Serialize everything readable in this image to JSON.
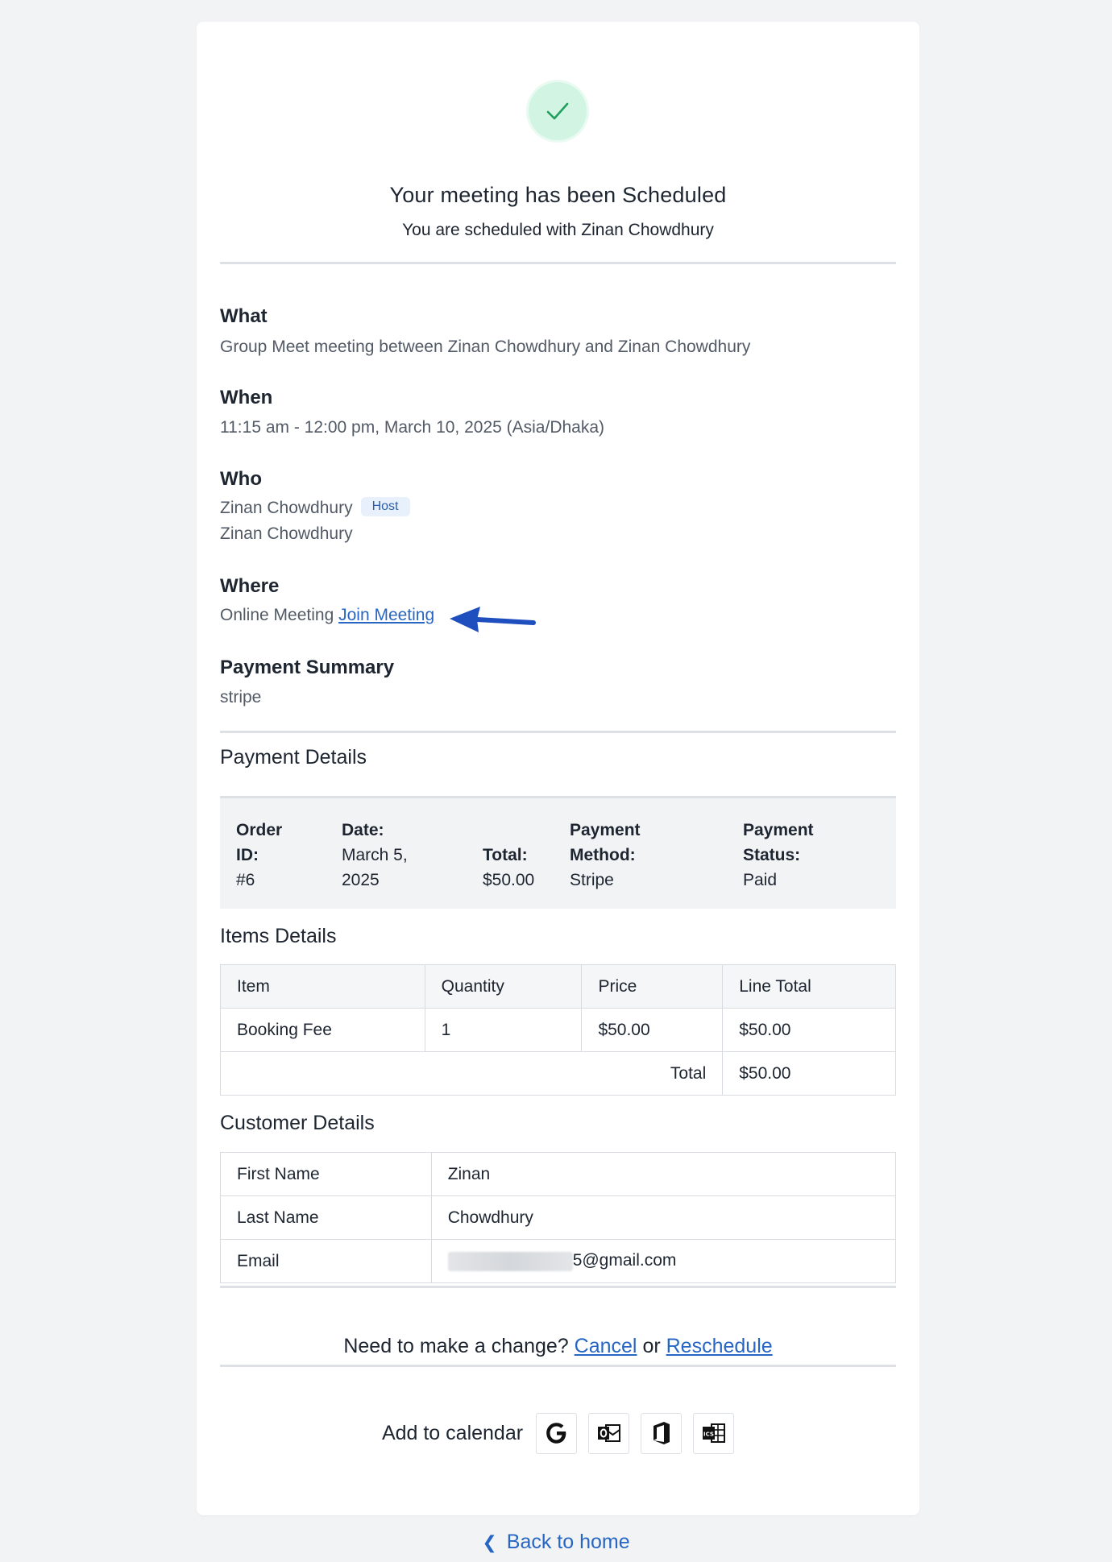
{
  "header": {
    "title": "Your meeting has been Scheduled",
    "subtitle": "You are scheduled with Zinan Chowdhury"
  },
  "what": {
    "label": "What",
    "value": "Group Meet meeting between Zinan Chowdhury and Zinan Chowdhury"
  },
  "when": {
    "label": "When",
    "value": "11:15 am - 12:00 pm, March 10, 2025 (Asia/Dhaka)"
  },
  "who": {
    "label": "Who",
    "host_name": "Zinan Chowdhury",
    "host_badge": "Host",
    "guest_name": "Zinan Chowdhury"
  },
  "where": {
    "label": "Where",
    "value": "Online Meeting",
    "link_text": "Join Meeting"
  },
  "payment_summary": {
    "label": "Payment Summary",
    "value": "stripe"
  },
  "payment_details": {
    "heading": "Payment Details",
    "order_id_label_1": "Order",
    "order_id_label_2": "ID:",
    "order_id_value": "#6",
    "date_label": "Date:",
    "date_value_1": "March 5,",
    "date_value_2": "2025",
    "total_label": "Total:",
    "total_value": "$50.00",
    "method_label_1": "Payment",
    "method_label_2": "Method:",
    "method_value": "Stripe",
    "status_label_1": "Payment",
    "status_label_2": "Status:",
    "status_value": "Paid"
  },
  "items": {
    "heading": "Items Details",
    "columns": [
      "Item",
      "Quantity",
      "Price",
      "Line Total"
    ],
    "rows": [
      [
        "Booking Fee",
        "1",
        "$50.00",
        "$50.00"
      ]
    ],
    "total_label": "Total",
    "total_value": "$50.00"
  },
  "customer": {
    "heading": "Customer Details",
    "rows": [
      [
        "First Name",
        "Zinan"
      ],
      [
        "Last Name",
        "Chowdhury"
      ],
      [
        "Email",
        "5@gmail.com"
      ]
    ]
  },
  "change": {
    "prefix": "Need to make a change?",
    "cancel": "Cancel",
    "or": "or",
    "reschedule": "Reschedule"
  },
  "calendar": {
    "label": "Add to calendar",
    "buttons": [
      "google-calendar-icon",
      "outlook-icon",
      "office365-icon",
      "ics-file-icon"
    ]
  },
  "footer": {
    "back_home": "Back to home"
  },
  "colors": {
    "accent": "#2766c2",
    "success": "#1f9e5e",
    "arrow": "#1f4fbf"
  }
}
